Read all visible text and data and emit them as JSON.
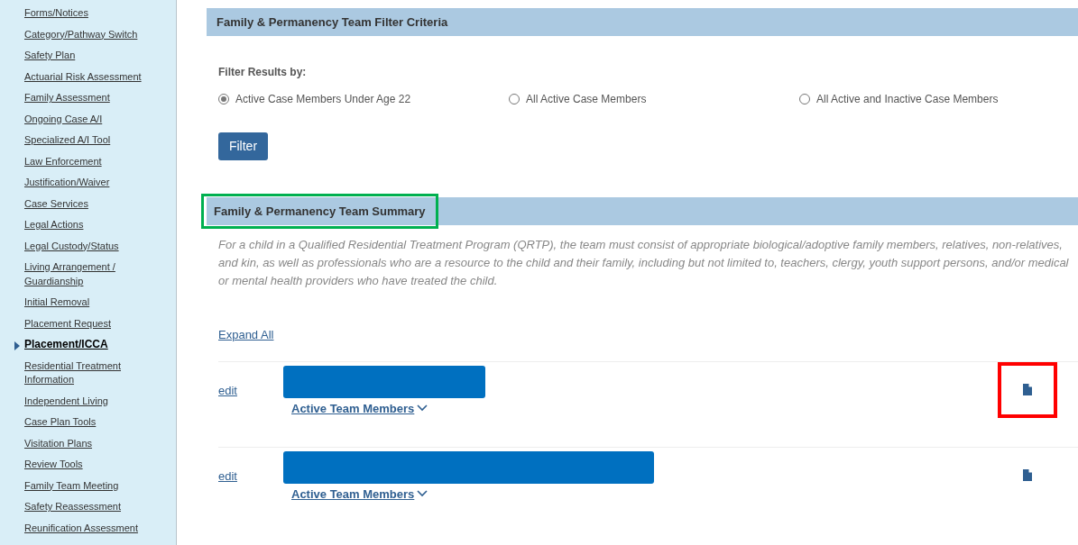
{
  "sidebar": {
    "items": [
      {
        "label": "Forms/Notices",
        "selected": false
      },
      {
        "label": "Category/Pathway Switch",
        "selected": false
      },
      {
        "label": "Safety Plan",
        "selected": false
      },
      {
        "label": "Actuarial Risk Assessment",
        "selected": false
      },
      {
        "label": "Family Assessment",
        "selected": false
      },
      {
        "label": "Ongoing Case A/I",
        "selected": false
      },
      {
        "label": "Specialized A/I Tool",
        "selected": false
      },
      {
        "label": "Law Enforcement",
        "selected": false
      },
      {
        "label": "Justification/Waiver",
        "selected": false
      },
      {
        "label": "Case Services",
        "selected": false
      },
      {
        "label": "Legal Actions",
        "selected": false
      },
      {
        "label": "Legal Custody/Status",
        "selected": false
      },
      {
        "label": "Living Arrangement / Guardianship",
        "selected": false
      },
      {
        "label": "Initial Removal",
        "selected": false
      },
      {
        "label": "Placement Request",
        "selected": false
      },
      {
        "label": "Placement/ICCA",
        "selected": true
      },
      {
        "label": "Residential Treatment Information",
        "selected": false
      },
      {
        "label": "Independent Living",
        "selected": false
      },
      {
        "label": "Case Plan Tools",
        "selected": false
      },
      {
        "label": "Visitation Plans",
        "selected": false
      },
      {
        "label": "Review Tools",
        "selected": false
      },
      {
        "label": "Family Team Meeting",
        "selected": false
      },
      {
        "label": "Safety Reassessment",
        "selected": false
      },
      {
        "label": "Reunification Assessment",
        "selected": false
      }
    ]
  },
  "filter": {
    "title": "Family & Permanency Team Filter Criteria",
    "label": "Filter Results by:",
    "options": [
      {
        "label": "Active Case Members Under Age 22",
        "selected": true
      },
      {
        "label": "All Active Case Members",
        "selected": false
      },
      {
        "label": "All Active and Inactive Case Members",
        "selected": false
      }
    ],
    "button": "Filter"
  },
  "summary": {
    "title": "Family & Permanency Team Summary",
    "title_outlined": true,
    "description": "For a child in a Qualified Residential Treatment Program (QRTP), the team must consist of appropriate biological/adoptive family members, relatives, non-relatives, and kin, as well as professionals who are a resource to the child and their family, including but not limited to, teachers, clergy, youth support persons, and/or medical or mental health providers who have treated the child.",
    "expand_all": "Expand All",
    "rows": [
      {
        "edit": "edit",
        "kind": "short_redaction",
        "members": "Active Team Members",
        "icon_outlined": true
      },
      {
        "edit": "edit",
        "kind": "long_redaction",
        "members": "Active Team Members",
        "icon_outlined": false
      }
    ]
  }
}
